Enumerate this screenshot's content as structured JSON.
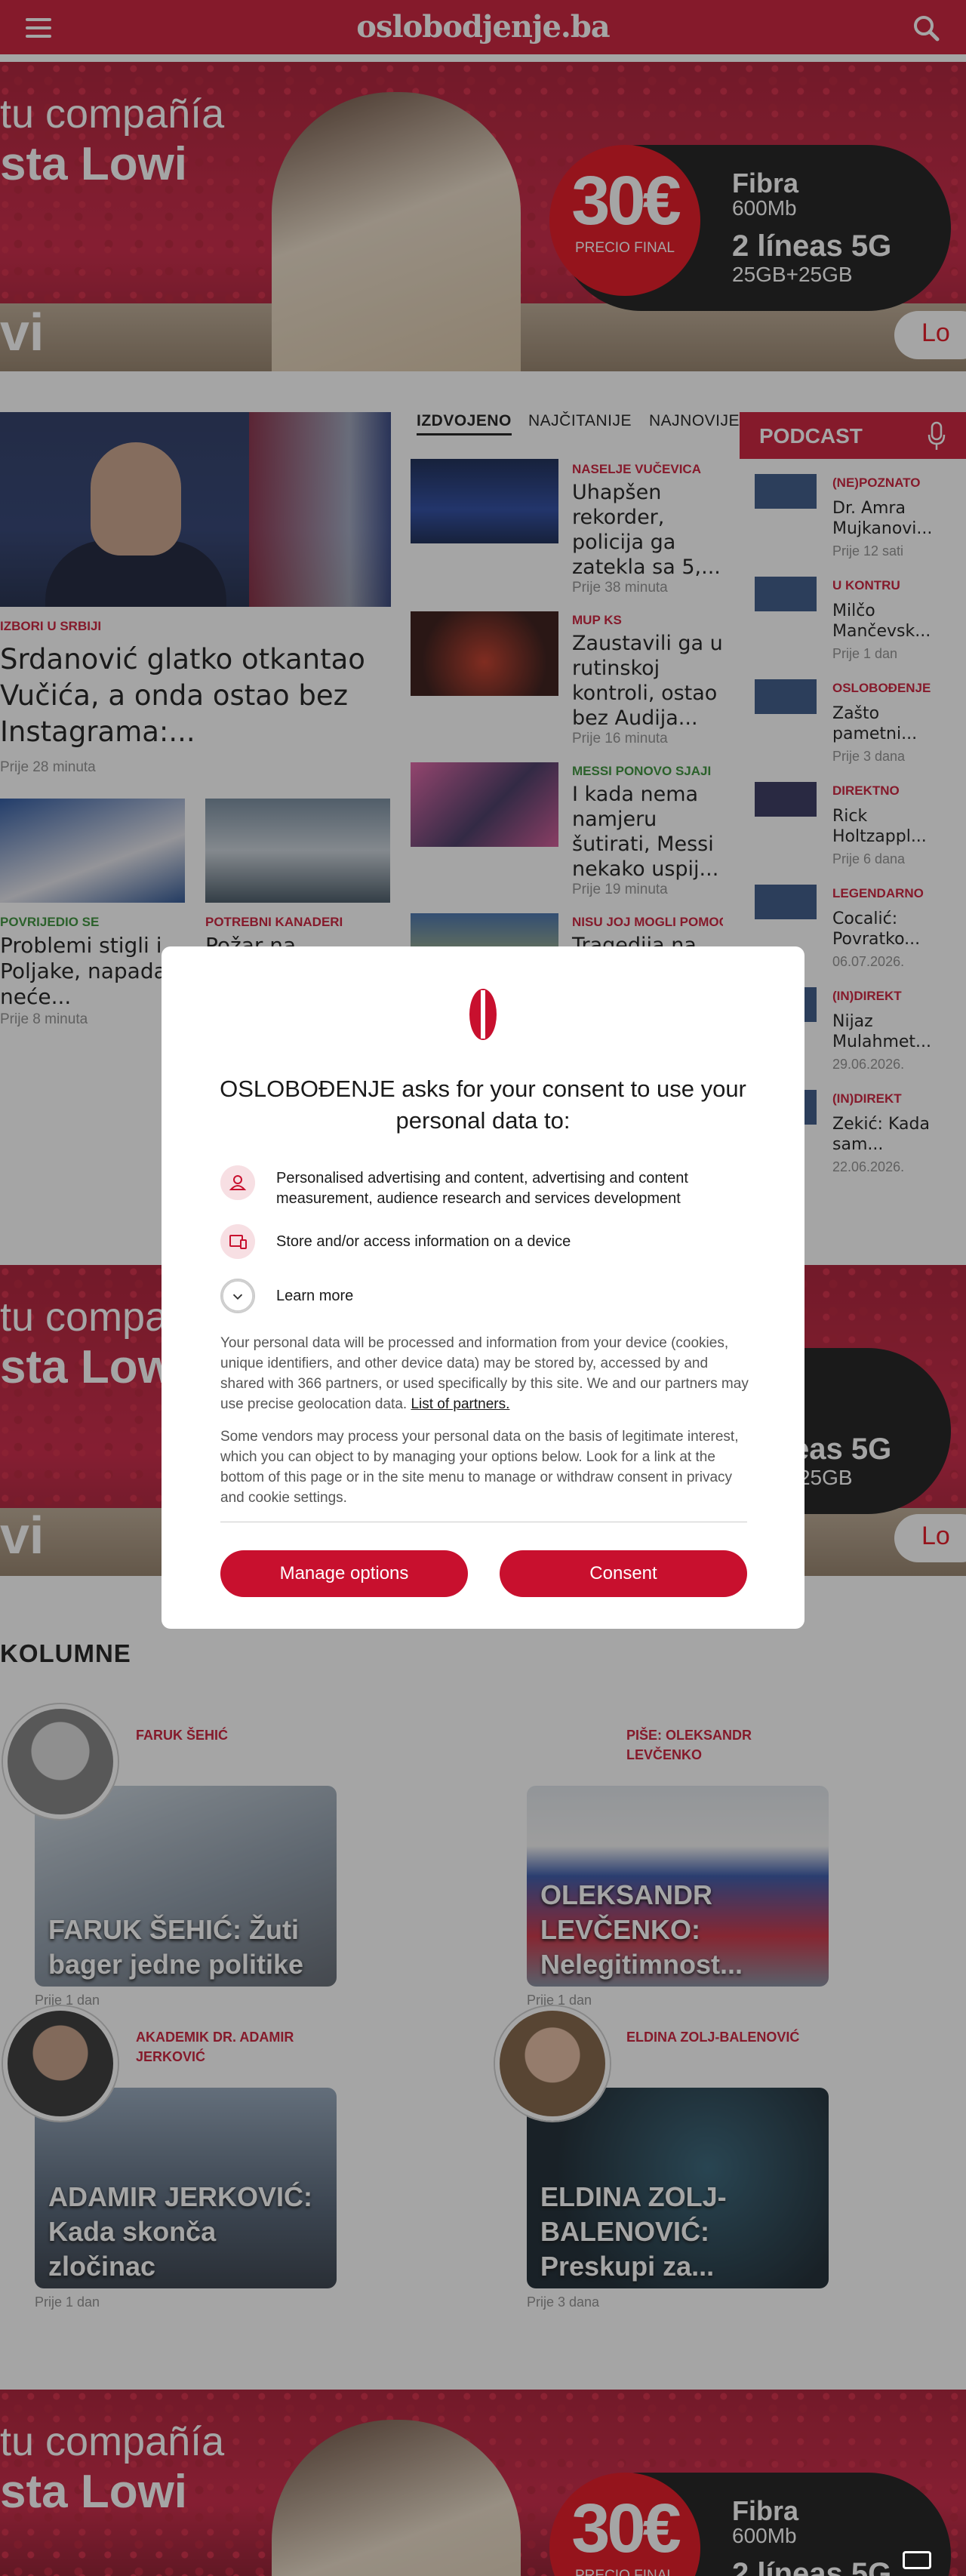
{
  "header": {
    "logo": "oslobodjenje.ba"
  },
  "ad": {
    "line1": "tu compañía",
    "line2": "sta Lowi",
    "price": "30€",
    "price_label": "PRECIO FINAL",
    "fibra": "Fibra",
    "mb": "600Mb",
    "lineas": "2 líneas 5G",
    "gb": "25GB+25GB",
    "cta": "Lo",
    "vi": "vi"
  },
  "featured": {
    "kicker": "IZBORI U SRBIJI",
    "title": "Srdanović glatko otkantao Vučića, a onda ostao bez Instagrama:...",
    "time": "Prije 28 minuta"
  },
  "small_articles": [
    {
      "kicker": "POVRIJEDIO SE",
      "title": "Problemi stigli i Poljake, napadač neće...",
      "time": "Prije 8 minuta"
    },
    {
      "kicker": "POTREBNI KANADERI",
      "title": "Požar na",
      "time": ""
    }
  ],
  "tabs": [
    "IZDVOJENO",
    "NAJČITANIJE",
    "NAJNOVIJE"
  ],
  "list_articles": [
    {
      "kicker": "NASELJE VUČEVICA",
      "title": "Uhapšen rekorder, policija ga zatekla sa 5,...",
      "time": "Prije 38 minuta"
    },
    {
      "kicker": "MUP KS",
      "title": "Zaustavili ga u rutinskoj kontroli, ostao bez Audija...",
      "time": "Prije 16 minuta"
    },
    {
      "kicker": "MESSI PONOVO SJAJI",
      "title": "I kada nema namjeru šutirati, Messi nekako uspij...",
      "time": "Prije 19 minuta"
    },
    {
      "kicker": "NISU JOJ MOGLI POMOĆI",
      "title": "Tragedija na",
      "time": ""
    }
  ],
  "podcast": {
    "heading": "PODCAST",
    "items": [
      {
        "kicker": "(NE)POZNATO",
        "title": "Dr. Amra Mujkanovi...",
        "time": "Prije 12 sati"
      },
      {
        "kicker": "U KONTRU",
        "title": "Milčo Mančevsk...",
        "time": "Prije 1 dan"
      },
      {
        "kicker": "OSLOBOĐENJE",
        "title": "Zašto pametni...",
        "time": "Prije 3 dana"
      },
      {
        "kicker": "DIREKTNO",
        "title": "Rick Holtzappl...",
        "time": "Prije 6 dana"
      },
      {
        "kicker": "LEGENDARNO",
        "title": "Cocalić: Povratko...",
        "time": "06.07.2026."
      },
      {
        "kicker": "(IN)DIREKT",
        "title": "Nijaz Mulahmet...",
        "time": "29.06.2026."
      },
      {
        "kicker": "(IN)DIREKT",
        "title": "Zekić: Kada sam...",
        "time": "22.06.2026."
      }
    ]
  },
  "columns": {
    "heading": "KOLUMNE",
    "items": [
      {
        "author": "FARUK ŠEHIĆ",
        "title": "FARUK ŠEHIĆ: Žuti bager jedne politike",
        "time": "Prije 1 dan"
      },
      {
        "author": "PIŠE: OLEKSANDR LEVČENKO",
        "title": "OLEKSANDR LEVČENKO: Nelegitimnost...",
        "time": "Prije 1 dan"
      },
      {
        "author": "AKADEMIK DR. ADAMIR JERKOVIĆ",
        "title": "ADAMIR JERKOVIĆ: Kada skonča zločinac",
        "time": "Prije 1 dan"
      },
      {
        "author": "ELDINA ZOLJ-BALENOVIĆ",
        "title": "ELDINA ZOLJ-BALENOVIĆ: Preskupi za...",
        "time": "Prije 3 dana"
      }
    ]
  },
  "consent": {
    "title": "OSLOBOĐENJE asks for your consent to use your personal data to:",
    "purpose1": "Personalised advertising and content, advertising and content measurement, audience research and services development",
    "purpose2": "Store and/or access information on a device",
    "learn_more": "Learn more",
    "para1": "Your personal data will be processed and information from your device (cookies, unique identifiers, and other device data) may be stored by, accessed by and shared with 366 partners, or used specifically by this site. We and our partners may use precise geolocation data.",
    "partners_link": "List of partners.",
    "para2": "Some vendors may process your personal data on the basis of legitimate interest, which you can object to by managing your options below. Look for a link at the bottom of this page or in the site menu to manage or withdraw consent in privacy and cookie settings.",
    "manage_label": "Manage options",
    "consent_label": "Consent"
  },
  "colors": {
    "brand": "#c8102e",
    "kicker_green": "#2e8b2e"
  }
}
